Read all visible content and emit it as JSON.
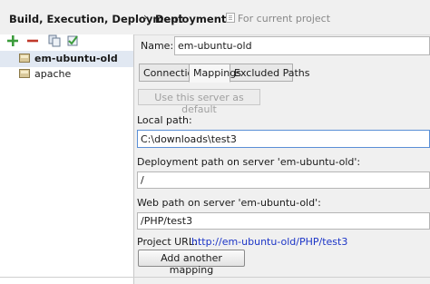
{
  "breadcrumb": {
    "parent": "Build, Execution, Deployment",
    "separator": "›",
    "current": "Deployment",
    "scope": "For current project"
  },
  "toolbar": {
    "add_icon": "plus-icon",
    "remove_icon": "minus-icon",
    "copy_icon": "copy-icon",
    "default_icon": "check-icon",
    "colors": {
      "add": "#3c9c3c",
      "remove": "#c0392b",
      "copy": "#6b7c93",
      "check": "#3c9c3c"
    }
  },
  "servers": [
    {
      "label": "em-ubuntu-old",
      "selected": true,
      "icon": "server-icon"
    },
    {
      "label": "apache",
      "selected": false,
      "icon": "server-icon"
    }
  ],
  "form": {
    "name_label": "Name:",
    "name_value": "em-ubuntu-old",
    "tabs": [
      {
        "label": "Connection",
        "active": false
      },
      {
        "label": "Mappings",
        "active": true
      },
      {
        "label": "Excluded Paths",
        "active": false
      }
    ],
    "default_button": "Use this server as default",
    "local_path_label": "Local path:",
    "local_path_value": "C:\\downloads\\test3",
    "deployment_path_label": "Deployment path on server 'em-ubuntu-old':",
    "deployment_path_value": "/",
    "web_path_label": "Web path on server 'em-ubuntu-old':",
    "web_path_value": "/PHP/test3",
    "project_url_label": "Project URL:",
    "project_url_value": "http://em-ubuntu-old/PHP/test3",
    "add_mapping_button": "Add another mapping"
  },
  "colors": {
    "link": "#1c35c7",
    "selection": "#e1e8f2",
    "focus_border": "#5a8fd6"
  }
}
